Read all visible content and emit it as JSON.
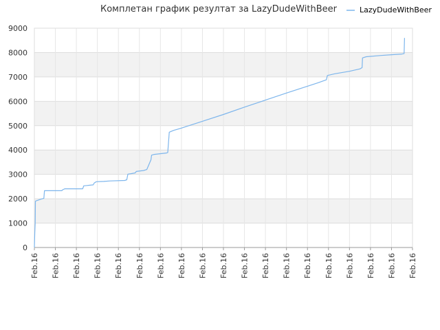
{
  "chart_data": {
    "type": "line",
    "title": "Комплетан график резултат за LazyDudeWithBeer",
    "legend_position": "top-right",
    "grid": true,
    "ylim": [
      0,
      9000
    ],
    "yticks": [
      0,
      1000,
      2000,
      3000,
      4000,
      5000,
      6000,
      7000,
      8000,
      9000
    ],
    "xticks": [
      "Feb.16",
      "Feb.16",
      "Feb.16",
      "Feb.16",
      "Feb.16",
      "Feb.16",
      "Feb.16",
      "Feb.16",
      "Feb.16",
      "Feb.16",
      "Feb.16",
      "Feb.16",
      "Feb.16",
      "Feb.16",
      "Feb.16",
      "Feb.16",
      "Feb.16",
      "Feb.16",
      "Feb.16"
    ],
    "xlim": [
      0,
      18
    ],
    "series": [
      {
        "name": "LazyDudeWithBeer",
        "color": "#7cb5ec",
        "points": [
          [
            0,
            0
          ],
          [
            0.01,
            300
          ],
          [
            0.02,
            600
          ],
          [
            0.04,
            1000
          ],
          [
            0.05,
            1900
          ],
          [
            0.1,
            1920
          ],
          [
            0.3,
            1980
          ],
          [
            0.45,
            2020
          ],
          [
            0.48,
            2330
          ],
          [
            1.3,
            2330
          ],
          [
            1.35,
            2370
          ],
          [
            1.45,
            2410
          ],
          [
            2.3,
            2410
          ],
          [
            2.35,
            2530
          ],
          [
            2.8,
            2570
          ],
          [
            2.85,
            2650
          ],
          [
            2.95,
            2700
          ],
          [
            3.3,
            2710
          ],
          [
            3.6,
            2730
          ],
          [
            4.3,
            2750
          ],
          [
            4.4,
            2780
          ],
          [
            4.45,
            3010
          ],
          [
            4.6,
            3030
          ],
          [
            4.8,
            3060
          ],
          [
            4.85,
            3120
          ],
          [
            5.2,
            3160
          ],
          [
            5.35,
            3200
          ],
          [
            5.5,
            3500
          ],
          [
            5.55,
            3600
          ],
          [
            5.58,
            3790
          ],
          [
            5.7,
            3820
          ],
          [
            6.3,
            3880
          ],
          [
            6.35,
            3900
          ],
          [
            6.4,
            4500
          ],
          [
            6.42,
            4730
          ],
          [
            6.6,
            4800
          ],
          [
            7.0,
            4900
          ],
          [
            8.0,
            5180
          ],
          [
            9.0,
            5460
          ],
          [
            10.0,
            5760
          ],
          [
            11.0,
            6050
          ],
          [
            12.0,
            6340
          ],
          [
            13.0,
            6620
          ],
          [
            13.5,
            6760
          ],
          [
            13.9,
            6880
          ],
          [
            13.95,
            7060
          ],
          [
            14.3,
            7130
          ],
          [
            15.0,
            7230
          ],
          [
            15.5,
            7330
          ],
          [
            15.6,
            7380
          ],
          [
            15.62,
            7780
          ],
          [
            15.8,
            7830
          ],
          [
            16.5,
            7880
          ],
          [
            17.0,
            7910
          ],
          [
            17.5,
            7940
          ],
          [
            17.6,
            7960
          ],
          [
            17.62,
            8600
          ]
        ]
      }
    ]
  }
}
